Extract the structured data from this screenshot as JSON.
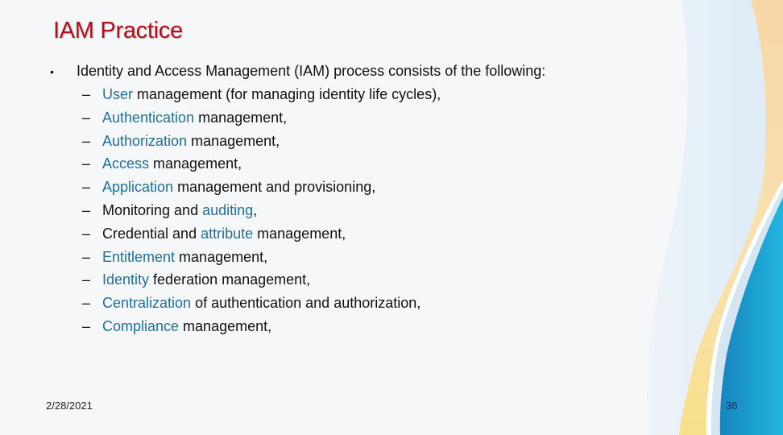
{
  "slide": {
    "title": "IAM Practice",
    "intro": "Identity and Access Management (IAM) process consists of the following:",
    "bullet_symbol": "•",
    "dash_symbol": "–",
    "items": [
      {
        "highlight": "User",
        "rest": " management (for managing identity life cycles),"
      },
      {
        "highlight": "Authentication",
        "rest": " management,"
      },
      {
        "highlight": "Authorization",
        "rest": " management,"
      },
      {
        "highlight": "Access",
        "rest": " management,"
      },
      {
        "highlight": "Application",
        "rest": " management and provisioning,"
      },
      {
        "prefix": "Monitoring and ",
        "highlight": "auditing",
        "rest": ","
      },
      {
        "prefix": "Credential and ",
        "highlight": "attribute",
        "rest": " management,"
      },
      {
        "highlight": "Entitlement",
        "rest": " management,"
      },
      {
        "highlight": "Identity",
        "rest": " federation management,"
      },
      {
        "highlight": "Centralization",
        "rest": " of authentication and authorization,"
      },
      {
        "highlight": "Compliance",
        "rest": " management,"
      }
    ],
    "date": "2/28/2021",
    "page_number": "36"
  },
  "colors": {
    "title": "#b3101c",
    "highlight": "#1f6f9c",
    "wave_orange": "#f7d9a8",
    "wave_blue": "#1a9fd0"
  }
}
